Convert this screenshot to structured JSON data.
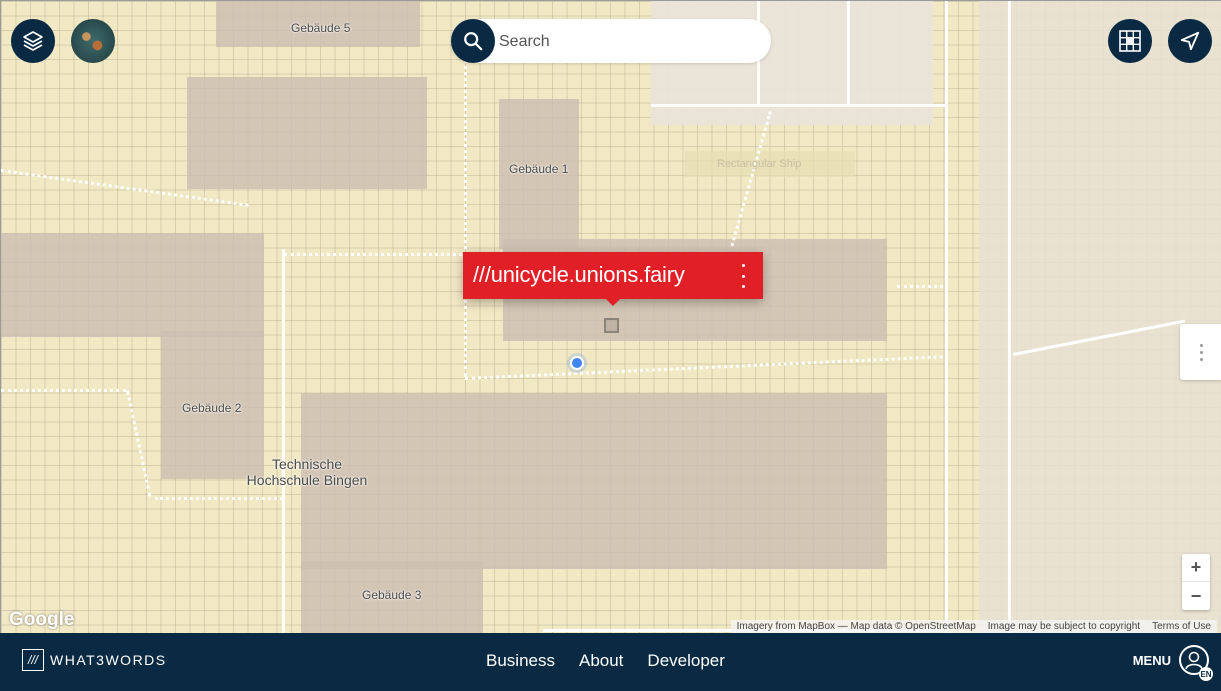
{
  "map": {
    "labels": {
      "gebaeude5": "Gebäude 5",
      "gebaeude1": "Gebäude 1",
      "gebaeude2": "Gebäude 2",
      "gebaeude3": "Gebäude 3",
      "campus_line1": "Technische",
      "campus_line2": "Hochschule Bingen",
      "shop": "Rectangular Ship"
    },
    "google_logo": "Google",
    "attribution": {
      "imagery": "Imagery from MapBox — Map data © OpenStreetMap",
      "copyright": "Image may be subject to copyright",
      "terms": "Terms of Use"
    },
    "zoom_in": "+",
    "zoom_out": "−"
  },
  "search": {
    "placeholder": "Search"
  },
  "popup": {
    "address": "///unicycle.unions.fairy"
  },
  "footer": {
    "brand_mark": "///",
    "brand_name": "WHAT3WORDS",
    "nav": [
      "Business",
      "About",
      "Developer"
    ],
    "menu_label": "MENU",
    "language": "EN"
  },
  "colors": {
    "navy": "#0a2a44",
    "w3w_red": "#e11f26",
    "location_blue": "#4285f4"
  },
  "icons": [
    "layers-icon",
    "search-icon",
    "grid-icon",
    "navigation-arrow-icon",
    "kebab-icon",
    "user-icon"
  ]
}
